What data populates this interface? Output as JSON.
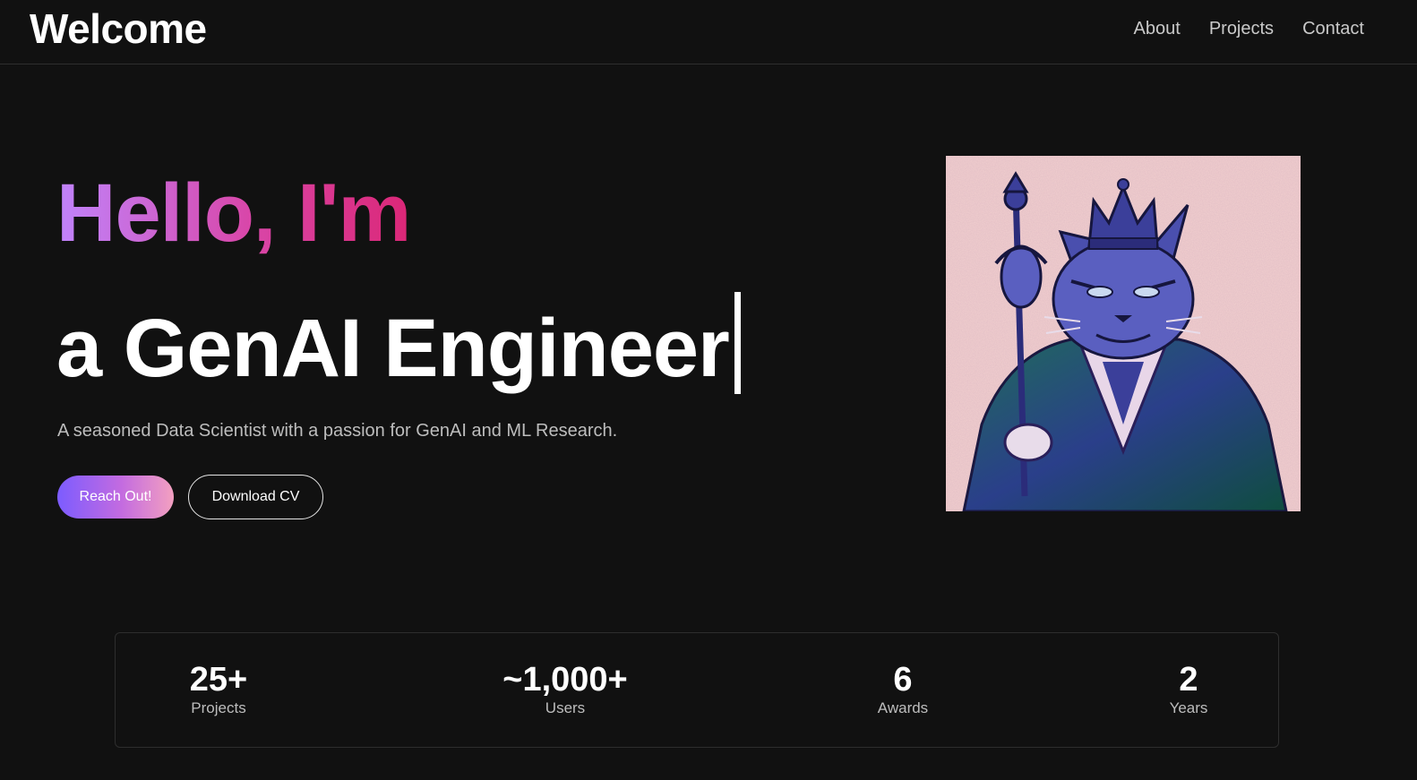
{
  "header": {
    "brand": "Welcome",
    "nav": [
      "About",
      "Projects",
      "Contact"
    ]
  },
  "hero": {
    "greeting": "Hello, I'm",
    "role": "a GenAI Engineer",
    "tagline": "A seasoned Data Scientist with a passion for GenAI and ML Research.",
    "primary_button": "Reach Out!",
    "secondary_button": "Download CV",
    "portrait": "crowned-cat-king-with-scepter"
  },
  "stats": [
    {
      "value": "25+",
      "label": "Projects"
    },
    {
      "value": "~1,000+",
      "label": "Users"
    },
    {
      "value": "6",
      "label": "Awards"
    },
    {
      "value": "2",
      "label": "Years"
    }
  ],
  "colors": {
    "background": "#111111",
    "gradient_start": "#c084fc",
    "gradient_end": "#db2777",
    "button_gradient_start": "#7c5cff",
    "button_gradient_end": "#f3a0c0"
  }
}
